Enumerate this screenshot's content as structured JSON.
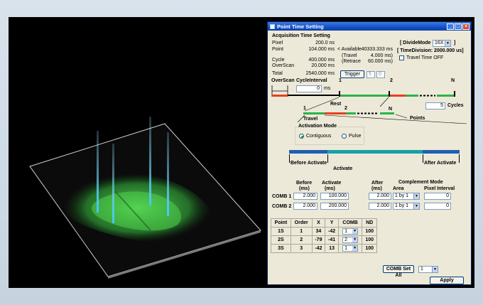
{
  "window": {
    "title": "Point Time Setting"
  },
  "acq": {
    "section": "Acquisition Time Setting",
    "pixel_label": "Pixel",
    "pixel_value": "200.0 ns",
    "point_label": "Point",
    "point_value": "104.000 ms",
    "available_label": "< Available",
    "available_value": "40333.333 ms",
    "travel_label": "(Travel",
    "travel_value": "4.000 ms)",
    "retrace_label": "(Retrace",
    "retrace_value": "60.000 ms)",
    "cycle_label": "Cycle",
    "cycle_value": "400.000 ms",
    "overscan_label": "OverScan",
    "overscan_value": "20.000 ms",
    "total_label": "Total",
    "total_value": "2540.000 ms"
  },
  "divide": {
    "label": "[ DivideMode",
    "value": "16X",
    "close": "]",
    "time_division": "[ TimeDivision: 2000.000 us]",
    "travel_time_label": "Travel Time OFF"
  },
  "trigger": {
    "label": "Trigger",
    "box1": "5",
    "box2": "0"
  },
  "timeline": {
    "overscan": "OverScan",
    "cycle_interval": "CycleInterval",
    "interval_value": "0",
    "interval_unit": "ms",
    "mark1": "1",
    "mark2": "2",
    "markN": "N",
    "rest": "Rest",
    "cycles_value": "5",
    "cycles_label": "Cycles",
    "sub1": "1",
    "sub2": "2",
    "subN": "N",
    "travel": "Travel",
    "points": "Points"
  },
  "activation": {
    "title": "Activation Mode",
    "contiguous": "Contiguous",
    "pulse": "Pulse",
    "before": "Before Activate",
    "after": "After Activate",
    "activate": "Activate"
  },
  "comb": {
    "h_before": "Before",
    "h_before_unit": "(ms)",
    "h_activate": "Activate",
    "h_activate_unit": "(ms)",
    "h_after": "After",
    "h_after_unit": "(ms)",
    "h_comp": "Complement Mode",
    "h_area": "Area",
    "h_pixel_interval": "Pixel Interval",
    "rows": [
      {
        "name": "COMB 1",
        "before": "2.000",
        "activate": "100.000",
        "after": "2.000",
        "area": "1 by 1",
        "interval": "0"
      },
      {
        "name": "COMB 2",
        "before": "2.000",
        "activate": "200.000",
        "after": "2.000",
        "area": "1 by 1",
        "interval": "0"
      }
    ]
  },
  "points": {
    "headers": [
      "Point",
      "Order",
      "X",
      "Y",
      "COMB",
      "ND"
    ],
    "rows": [
      {
        "point": "1S",
        "order": "1",
        "x": "34",
        "y": "-42",
        "comb": "1",
        "nd": "100"
      },
      {
        "point": "2S",
        "order": "2",
        "x": "-79",
        "y": "-41",
        "comb": "2",
        "nd": "100"
      },
      {
        "point": "3S",
        "order": "3",
        "x": "-42",
        "y": "13",
        "comb": "1",
        "nd": "100"
      }
    ]
  },
  "footer": {
    "comb_set_all": "COMB Set All",
    "comb_set_value": "1",
    "apply": "Apply"
  },
  "colors": {
    "rest_bar": "#e8401c",
    "active_bar": "#2bb34a",
    "activate_band": "#17a0a8",
    "edge_band": "#1e5fb3",
    "title_blue": "#1450c8"
  },
  "icons": [
    "window-icon",
    "minimize-icon",
    "maximize-icon",
    "close-icon",
    "dropdown-arrow-icon"
  ]
}
